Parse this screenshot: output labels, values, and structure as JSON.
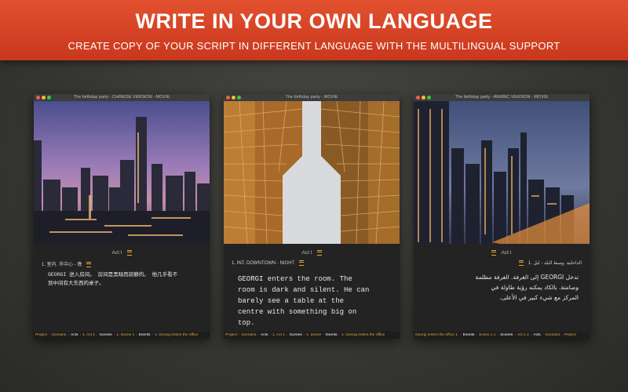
{
  "banner": {
    "title": "WRITE IN YOUR OWN LANGUAGE",
    "subtitle": "CREATE COPY OF YOUR SCRIPT IN DIFFERENT LANGUAGE WITH THE MULTILINGUAL SUPPORT"
  },
  "windows": [
    {
      "title": "The birthday party - CHINESE VERSION - MOVIE",
      "act": "Act I",
      "scene": "1. 室内. 市中心 - 晚",
      "body": "GEORGI 进入房间。 房间是黑暗而寂静的。 他几乎看不\n到中间有大东西的桌子。",
      "path": [
        "Project",
        "Scenario",
        "Acts",
        "1. Act 1",
        "Scenes",
        "1. Scene 1",
        "Events",
        "1. Georgi enters the office"
      ]
    },
    {
      "title": "The birthday party - MOVIE",
      "act": "Act I",
      "scene": "1. INT. DOWNTOWN - NIGHT",
      "body": "GEORGI enters the room. The\nroom is dark and silent. He can\nbarely see a table at the\ncentre with something big on\ntop.",
      "path": [
        "Project",
        "Scenario",
        "Acts",
        "1. Act 1",
        "Scenes",
        "1. Scene",
        "Events",
        "1. Georgi enters the office"
      ]
    },
    {
      "title": "The birthday party - ARABIC VERSION - MOVIE",
      "act": "Act I",
      "scene": "1. الداخلية. وسط البلد - ليل",
      "body": "تدخل GEORGI إلى الغرفة. الغرفة مظلمة\nوصامتة. بالكاد يمكنه رؤية طاولة في\nالمركز مع شيء كبير في الأعلى.",
      "path": [
        "Georgi enters the office 1.",
        "Events",
        "Scene 1.1",
        "Scenes",
        "Act 1.1",
        "Acts",
        "Scenario",
        "Project"
      ]
    }
  ]
}
